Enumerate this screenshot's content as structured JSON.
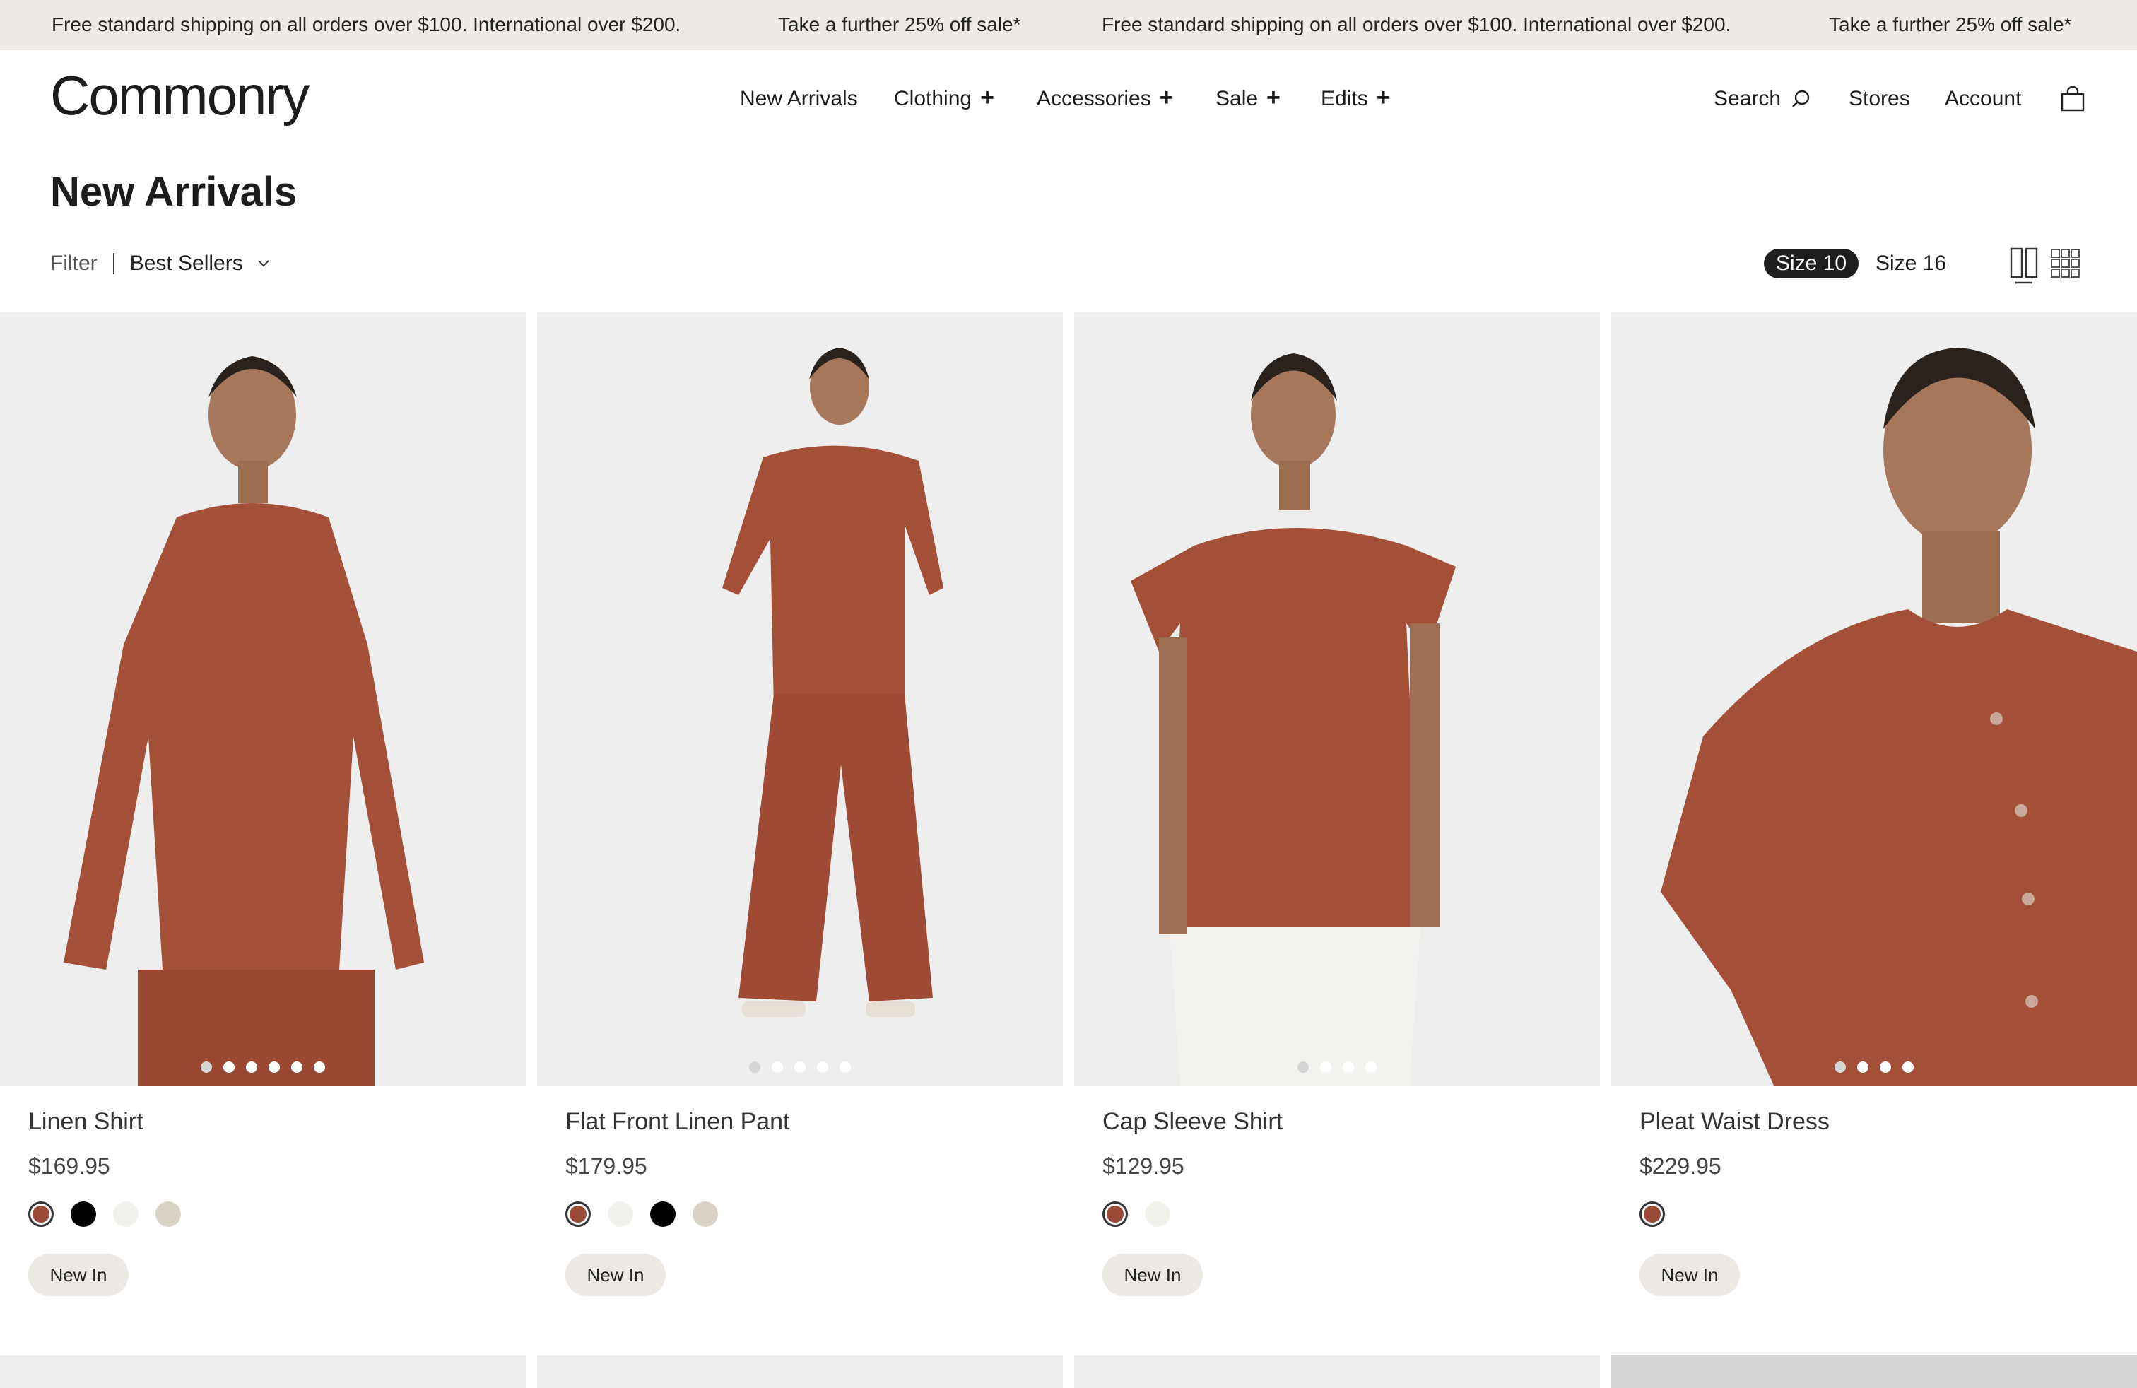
{
  "announcement": {
    "messages": [
      "Free standard shipping on all orders over $100. International over $200.",
      "Take a further 25% off sale*",
      "Free standard shipping on all orders over $100. International over $200.",
      "Take a further 25% off sale*"
    ]
  },
  "header": {
    "logo": "Commonry",
    "nav": [
      {
        "label": "New Arrivals",
        "expandable": false
      },
      {
        "label": "Clothing",
        "expandable": true
      },
      {
        "label": "Accessories",
        "expandable": true
      },
      {
        "label": "Sale",
        "expandable": true
      },
      {
        "label": "Edits",
        "expandable": true
      }
    ],
    "plus": "+",
    "search_label": "Search",
    "stores_label": "Stores",
    "account_label": "Account",
    "icons": {
      "search": "search-icon",
      "bag": "shopping-bag-icon",
      "sort": "chevron-down-icon",
      "grid2": "two-column-grid-icon",
      "grid3": "three-column-grid-icon"
    }
  },
  "page": {
    "title": "New Arrivals",
    "filter_label": "Filter",
    "sort_label": "Best Sellers",
    "sizes": [
      {
        "label": "Size 10",
        "active": true
      },
      {
        "label": "Size 16",
        "active": false
      }
    ]
  },
  "products": [
    {
      "name": "Linen Shirt",
      "price": "$169.95",
      "badge": "New In",
      "image_dots": 6,
      "active_dot": 1,
      "swatches": [
        "#9b4a36",
        "#000000",
        "#f2f1ec",
        "#d9d2c7"
      ],
      "selected_swatch": 0
    },
    {
      "name": "Flat Front Linen Pant",
      "price": "$179.95",
      "badge": "New In",
      "image_dots": 5,
      "active_dot": 1,
      "swatches": [
        "#9b4a36",
        "#f2f1ec",
        "#000000",
        "#d9d2c7"
      ],
      "selected_swatch": 0
    },
    {
      "name": "Cap Sleeve Shirt",
      "price": "$129.95",
      "badge": "New In",
      "image_dots": 4,
      "active_dot": 1,
      "swatches": [
        "#9b4a36",
        "#f2f1ec"
      ],
      "selected_swatch": 0
    },
    {
      "name": "Pleat Waist Dress",
      "price": "$229.95",
      "badge": "New In",
      "image_dots": 4,
      "active_dot": 1,
      "swatches": [
        "#9b4a36"
      ],
      "selected_swatch": 0
    }
  ],
  "colors": {
    "rust": "#a44f38",
    "announce_bg": "#eeebe6",
    "badge_bg": "#ece9e4"
  }
}
